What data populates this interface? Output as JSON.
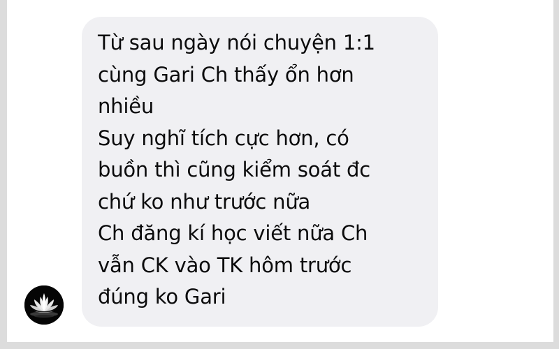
{
  "conversation": {
    "avatar_icon": "lotus-flower-icon",
    "bubble_color": "#f0f0f3",
    "message": {
      "lines": [
        "Từ sau ngày nói chuyện 1:1",
        "cùng Gari Ch thấy ổn hơn",
        "nhiều",
        "Suy nghĩ tích cực hơn, có",
        "buồn thì cũng kiểm soát đc",
        "chứ ko như trước nữa",
        "Ch đăng kí học viết nữa Ch",
        "vẫn CK vào TK hôm trước",
        "đúng ko Gari"
      ]
    }
  }
}
